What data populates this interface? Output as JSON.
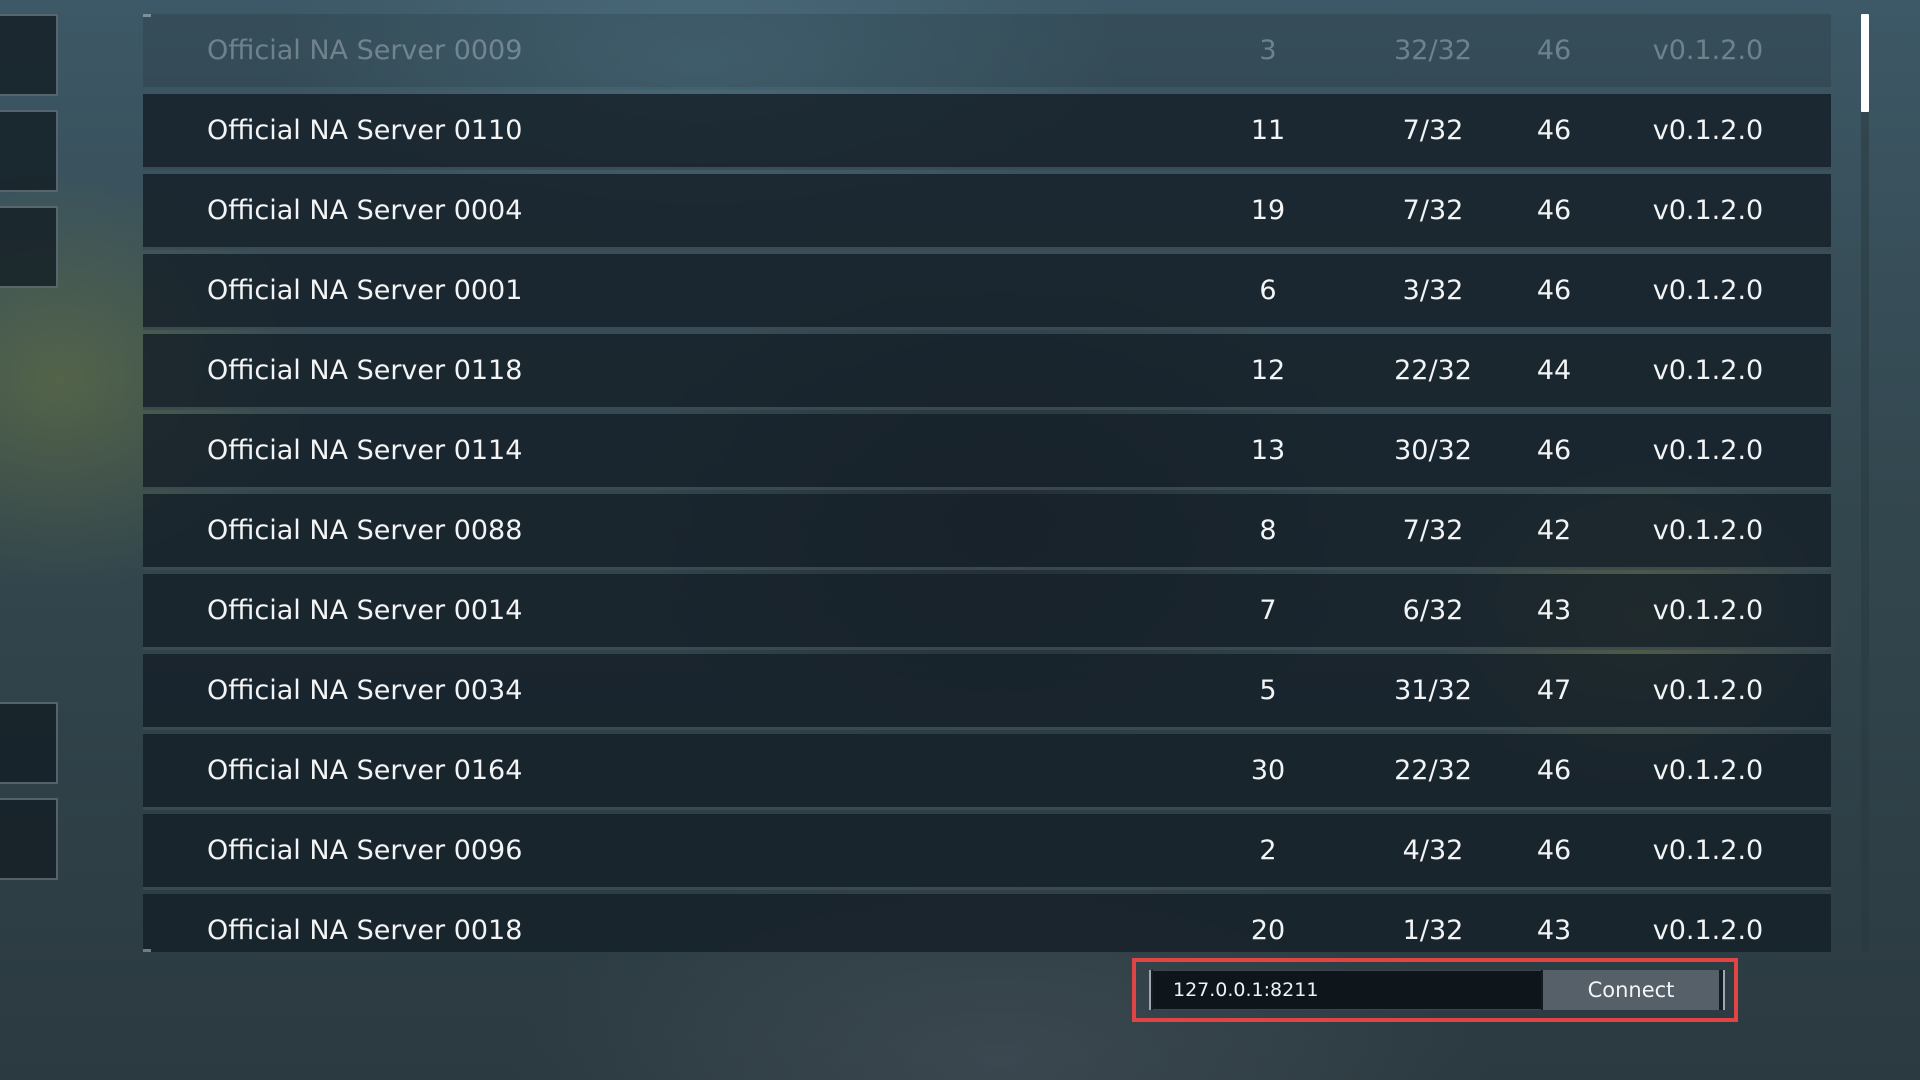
{
  "server_list": {
    "rows": [
      {
        "name": "Official NA Server 0009",
        "days": "3",
        "players": "32/32",
        "ping": "46",
        "version": "v0.1.2.0"
      },
      {
        "name": "Official NA Server 0110",
        "days": "11",
        "players": "7/32",
        "ping": "46",
        "version": "v0.1.2.0"
      },
      {
        "name": "Official NA Server 0004",
        "days": "19",
        "players": "7/32",
        "ping": "46",
        "version": "v0.1.2.0"
      },
      {
        "name": "Official NA Server 0001",
        "days": "6",
        "players": "3/32",
        "ping": "46",
        "version": "v0.1.2.0"
      },
      {
        "name": "Official NA Server 0118",
        "days": "12",
        "players": "22/32",
        "ping": "44",
        "version": "v0.1.2.0"
      },
      {
        "name": "Official NA Server 0114",
        "days": "13",
        "players": "30/32",
        "ping": "46",
        "version": "v0.1.2.0"
      },
      {
        "name": "Official NA Server 0088",
        "days": "8",
        "players": "7/32",
        "ping": "42",
        "version": "v0.1.2.0"
      },
      {
        "name": "Official NA Server 0014",
        "days": "7",
        "players": "6/32",
        "ping": "43",
        "version": "v0.1.2.0"
      },
      {
        "name": "Official NA Server 0034",
        "days": "5",
        "players": "31/32",
        "ping": "47",
        "version": "v0.1.2.0"
      },
      {
        "name": "Official NA Server 0164",
        "days": "30",
        "players": "22/32",
        "ping": "46",
        "version": "v0.1.2.0"
      },
      {
        "name": "Official NA Server 0096",
        "days": "2",
        "players": "4/32",
        "ping": "46",
        "version": "v0.1.2.0"
      },
      {
        "name": "Official NA Server 0018",
        "days": "20",
        "players": "1/32",
        "ping": "43",
        "version": "v0.1.2.0"
      }
    ],
    "scroll_position": 0.0
  },
  "connect_bar": {
    "address_value": "127.0.0.1:8211",
    "connect_label": "Connect"
  },
  "colors": {
    "highlight_border": "#e04545",
    "row_background": "#16202a",
    "text": "#f2f4f5"
  }
}
